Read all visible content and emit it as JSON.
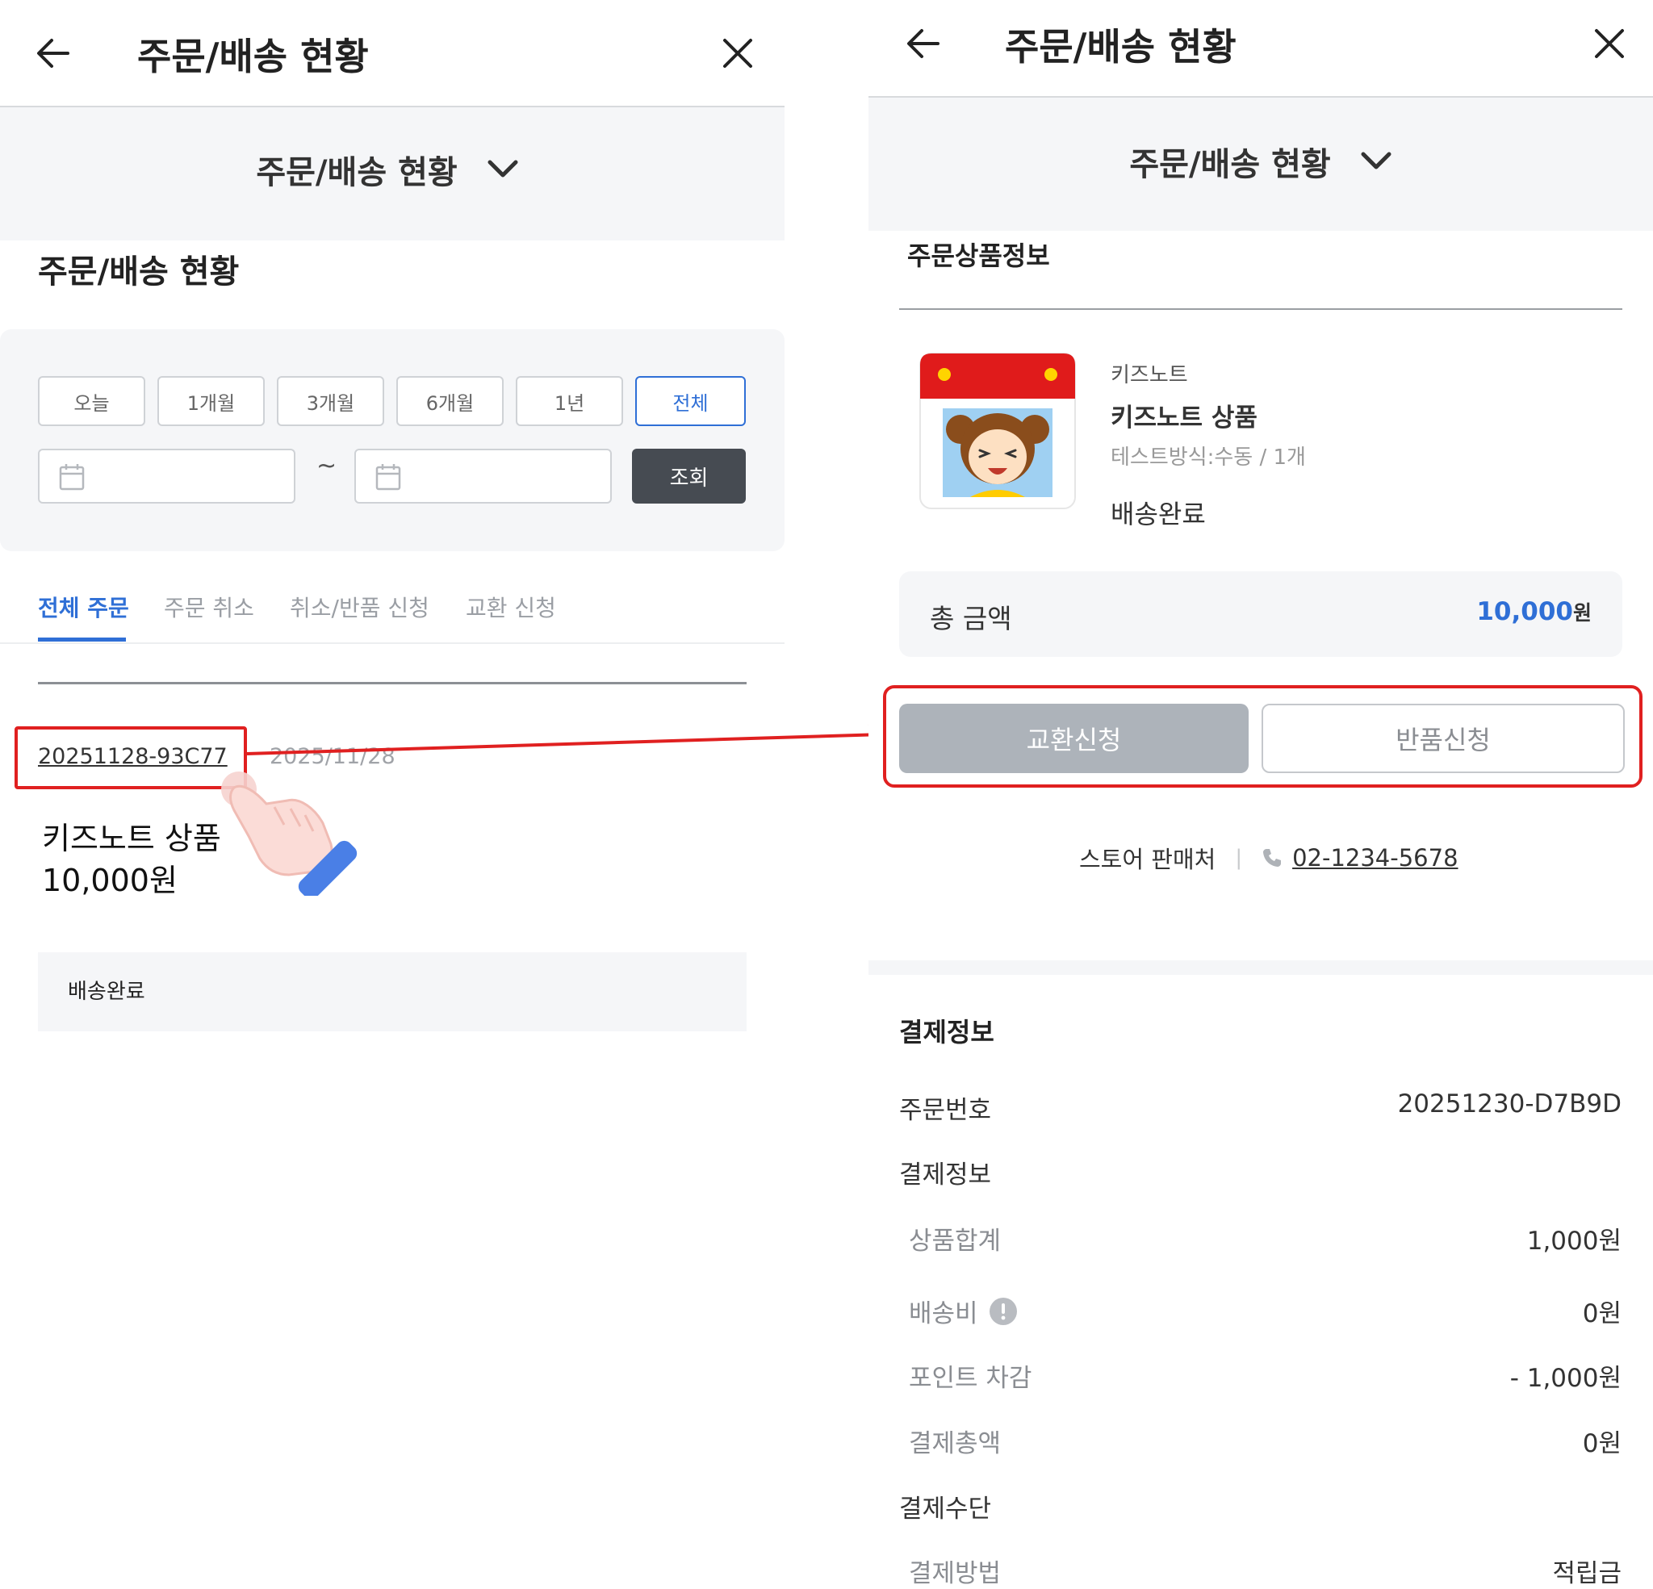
{
  "left": {
    "header": {
      "title": "주문/배송 현황"
    },
    "dropdown": {
      "label": "주문/배송 현황"
    },
    "section_title": "주문/배송 현황",
    "period_buttons": [
      "오늘",
      "1개월",
      "3개월",
      "6개월",
      "1년",
      "전체"
    ],
    "period_active": "전체",
    "date_separator": "~",
    "search_button": "조회",
    "tabs": [
      "전체 주문",
      "주문 취소",
      "취소/반품 신청",
      "교환 신청"
    ],
    "active_tab": "전체 주문",
    "order": {
      "number": "20251128-93C77",
      "date": "2025/11/28",
      "product_name": "키즈노트 상품",
      "price": "10,000원",
      "status": "배송완료"
    }
  },
  "right": {
    "header": {
      "title": "주문/배송 현황"
    },
    "dropdown": {
      "label": "주문/배송 현황"
    },
    "product_section_title": "주문상품정보",
    "product": {
      "brand": "키즈노트",
      "name": "키즈노트 상품",
      "option": "테스트방식:수동 / 1개",
      "status": "배송완료"
    },
    "total": {
      "label": "총 금액",
      "amount": "10,000",
      "unit": "원"
    },
    "buttons": {
      "exchange": "교환신청",
      "return": "반품신청"
    },
    "seller": {
      "label": "스토어 판매처",
      "divider": "|",
      "phone": "02-1234-5678"
    },
    "payment": {
      "title": "결제정보",
      "order_no_label": "주문번호",
      "order_no_value": "20251230-D7B9D",
      "info_label": "결제정보",
      "subtotal_label": "상품합계",
      "subtotal_value": "1,000원",
      "shipping_label": "배송비",
      "shipping_value": "0원",
      "point_label": "포인트 차감",
      "point_value": "- 1,000원",
      "total_label": "결제총액",
      "total_value": "0원",
      "method_section_label": "결제수단",
      "method_label": "결제방법",
      "method_value": "적립금"
    }
  },
  "colors": {
    "accent_blue": "#2f6fd6",
    "annotation_red": "#e02020",
    "dark_button": "#464b52",
    "disabled_button": "#adb3ba",
    "gray_band": "#f5f6f8"
  }
}
